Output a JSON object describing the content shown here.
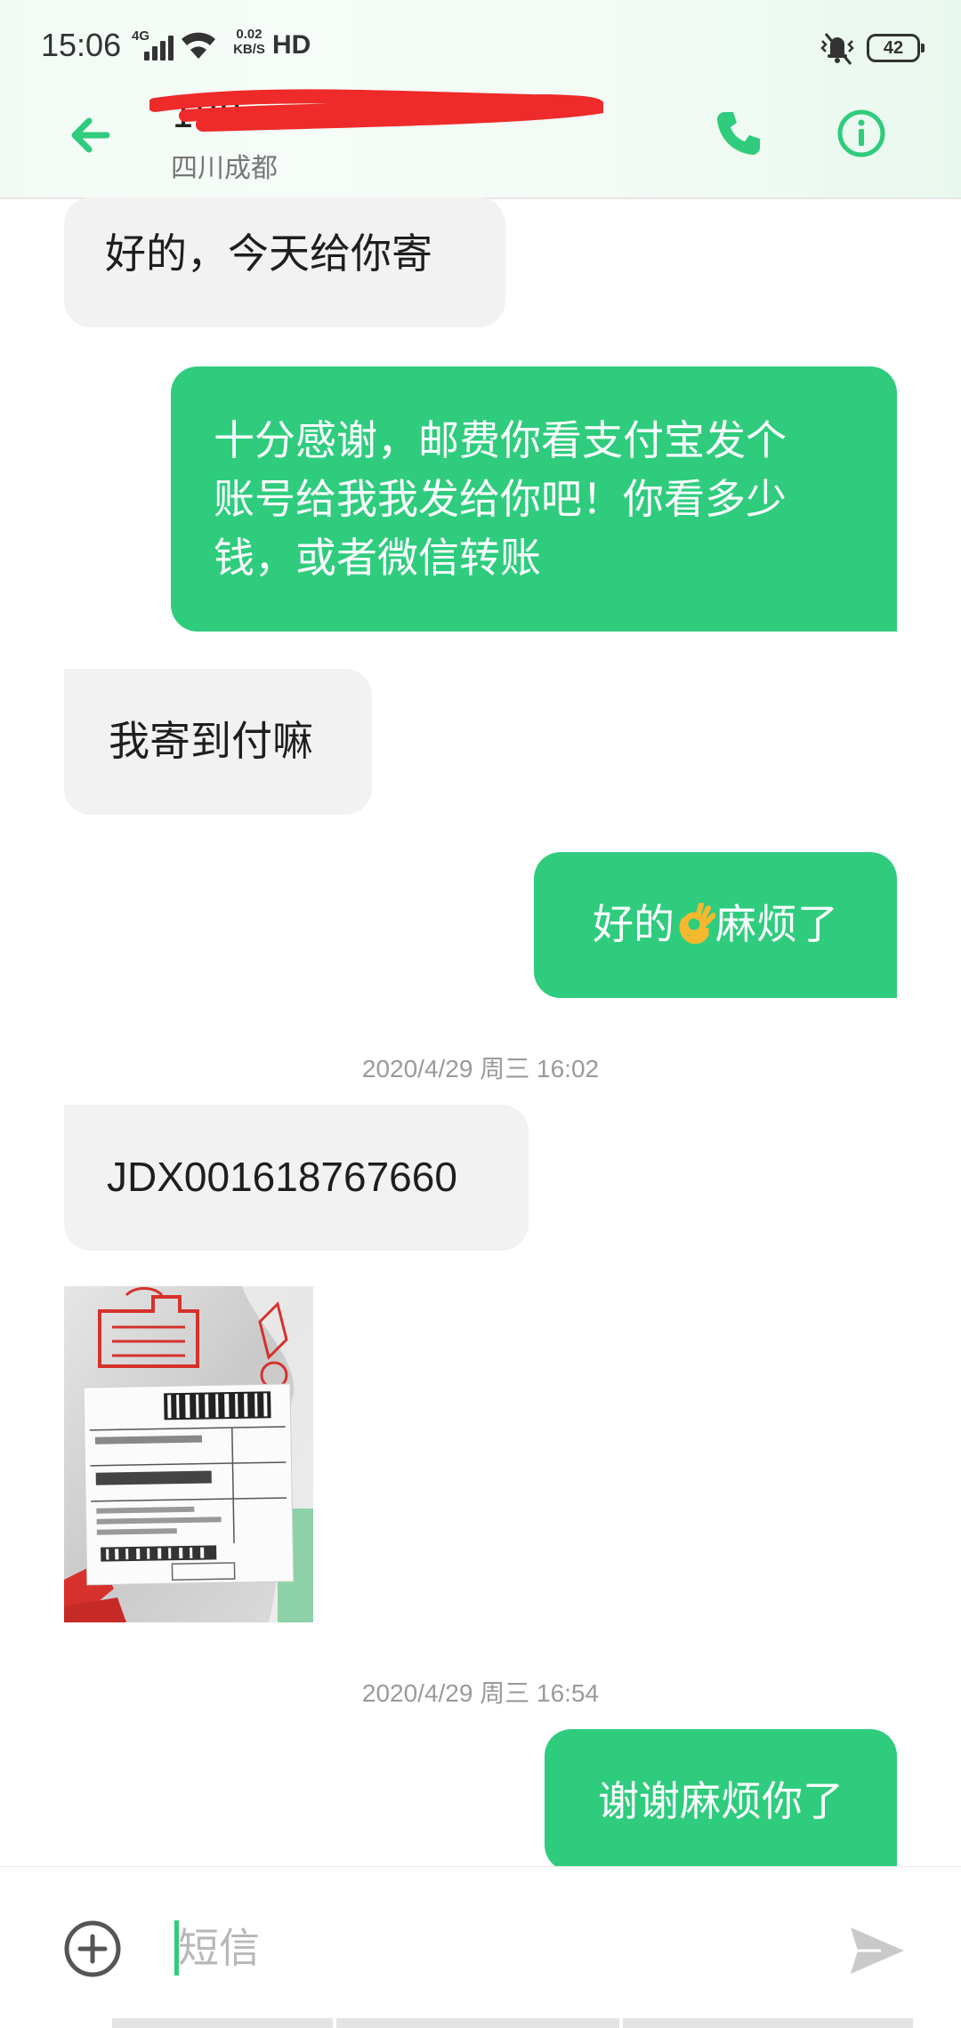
{
  "status_bar": {
    "time": "15:06",
    "network_type": "4G",
    "speed_value": "0.02",
    "speed_unit": "KB/S",
    "hd": "HD",
    "battery": "42"
  },
  "header": {
    "contact_number": "180",
    "location": "四川成都",
    "accent_color": "#2fcc7e"
  },
  "messages": [
    {
      "direction": "incoming",
      "text": "好的，今天给你寄"
    },
    {
      "direction": "outgoing",
      "text_lines": [
        "十分感谢，邮费你看支付宝发个",
        "账号给我我发给你吧！你看多少",
        "钱，或者微信转账"
      ]
    },
    {
      "direction": "incoming",
      "text": "我寄到付嘛"
    },
    {
      "direction": "outgoing",
      "text_before": "好的",
      "emoji": "ok-hand",
      "text_after": "麻烦了"
    },
    {
      "timestamp": "2020/4/29 周三 16:02"
    },
    {
      "direction": "incoming",
      "text": "JDX001618767660"
    },
    {
      "direction": "incoming",
      "type": "image"
    },
    {
      "timestamp": "2020/4/29 周三 16:54"
    },
    {
      "direction": "outgoing",
      "text": "谢谢麻烦你了"
    }
  ],
  "compose": {
    "placeholder": "短信"
  }
}
